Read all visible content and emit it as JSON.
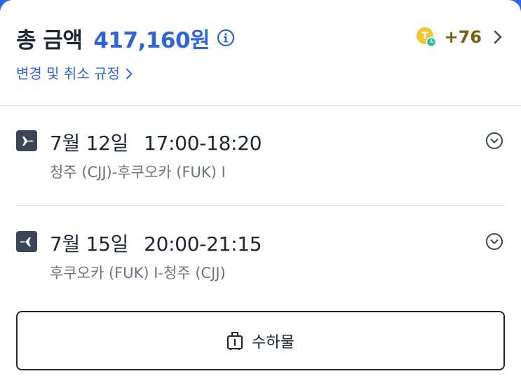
{
  "summary": {
    "total_label": "총 금액",
    "total_amount": "417,160원",
    "points_value": "+76",
    "policy_link": "변경 및 취소 규정",
    "icons": [
      "info-icon",
      "coin-icon",
      "chevron-right-icon"
    ]
  },
  "flights": [
    {
      "date": "7월 12일",
      "times": "17:00-18:20",
      "route": "청주 (CJJ)-후쿠오카 (FUK) I",
      "icon": "airplane-outbound-icon"
    },
    {
      "date": "7월 15일",
      "times": "20:00-21:15",
      "route": "후쿠오카 (FUK) I-청주 (CJJ)",
      "icon": "airplane-return-icon"
    }
  ],
  "baggage": {
    "label": "수하물",
    "icon": "luggage-icon"
  },
  "colors": {
    "accent": "#2f64d8",
    "text": "#1d2633",
    "muted": "#6b7280",
    "points": "#7a6112",
    "header_bg": "#2b67e6"
  }
}
